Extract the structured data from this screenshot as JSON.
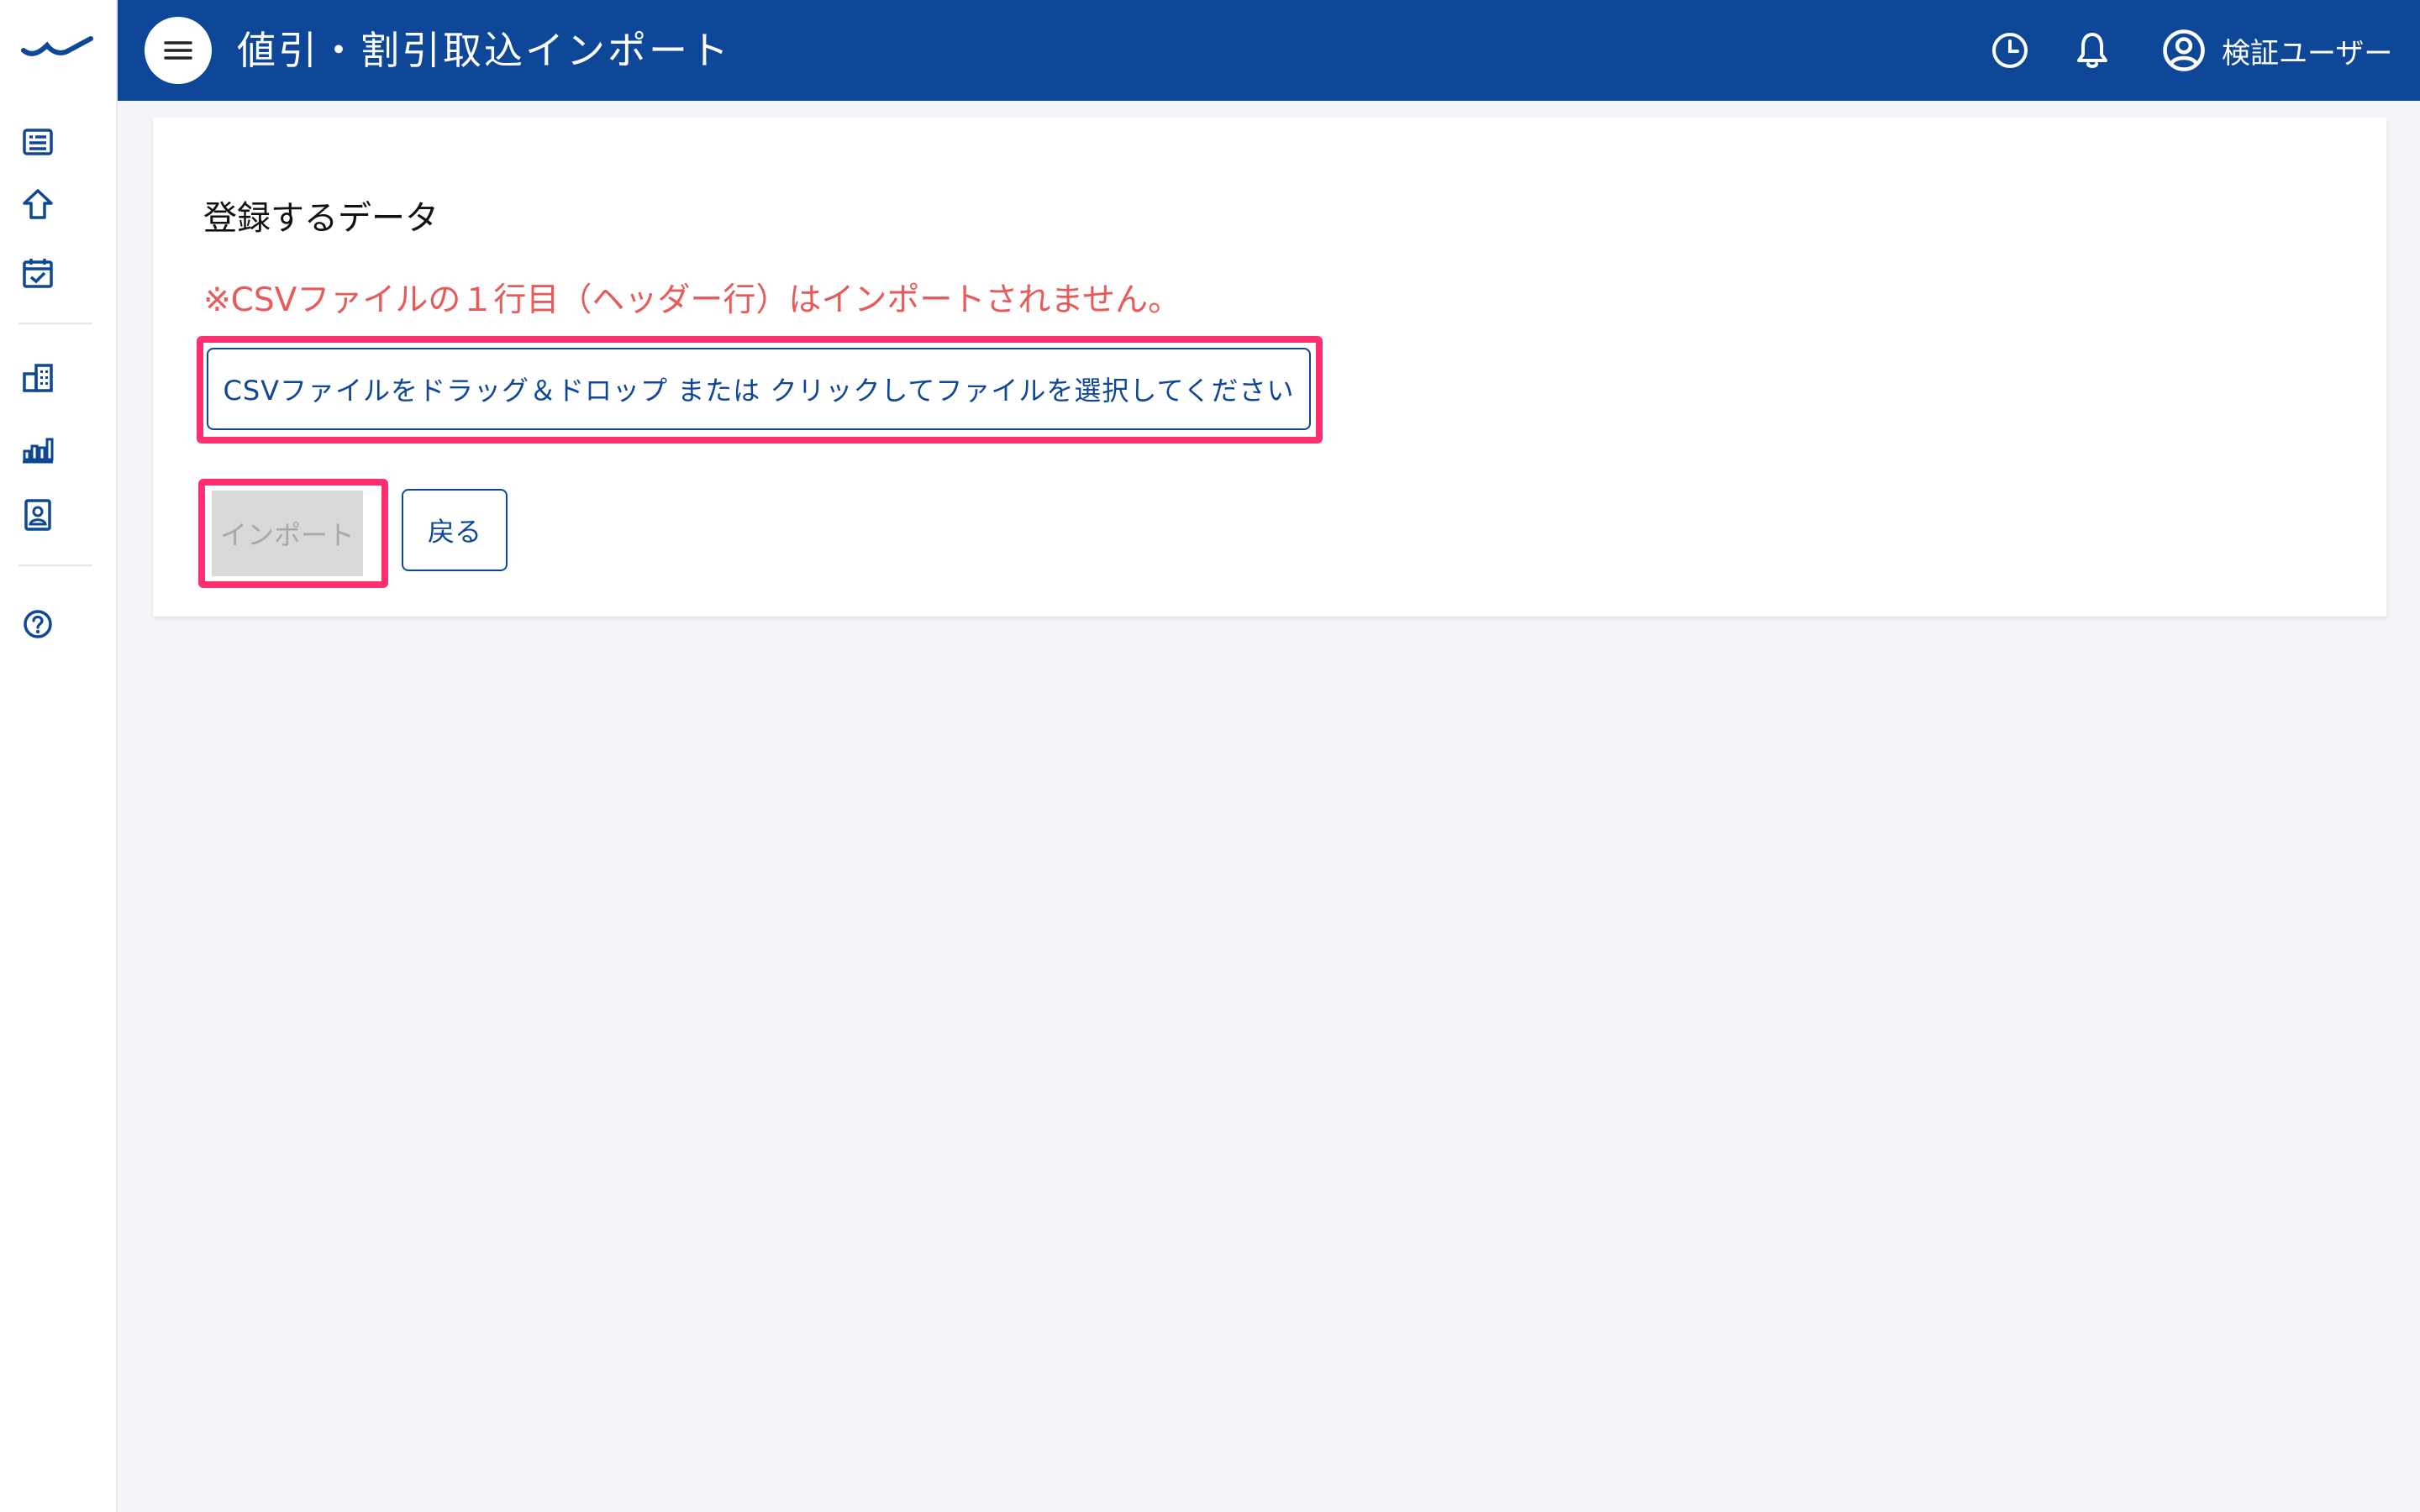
{
  "header": {
    "title": "値引・割引取込インポート",
    "user_name": "検証ユーザー",
    "bg_color": "#0f4798"
  },
  "sidebar": {
    "logo": "brand-wave-logo",
    "items": [
      {
        "icon": "list-icon"
      },
      {
        "icon": "home-icon"
      },
      {
        "icon": "calendar-check-icon"
      },
      {
        "icon": "building-icon"
      },
      {
        "icon": "bar-chart-icon"
      },
      {
        "icon": "contact-card-icon"
      },
      {
        "icon": "help-icon"
      }
    ]
  },
  "main": {
    "section_heading": "登録するデータ",
    "warning": "※CSVファイルの１行目（ヘッダー行）はインポートされません。",
    "dropzone_label": "CSVファイルをドラッグ＆ドロップ または クリックしてファイルを選択してください",
    "import_button": "インポート",
    "back_button": "戻る"
  },
  "colors": {
    "primary": "#0f4798",
    "warning": "#e85a5a",
    "highlight": "#ff2e6f",
    "disabled_bg": "#d9d9d9"
  }
}
